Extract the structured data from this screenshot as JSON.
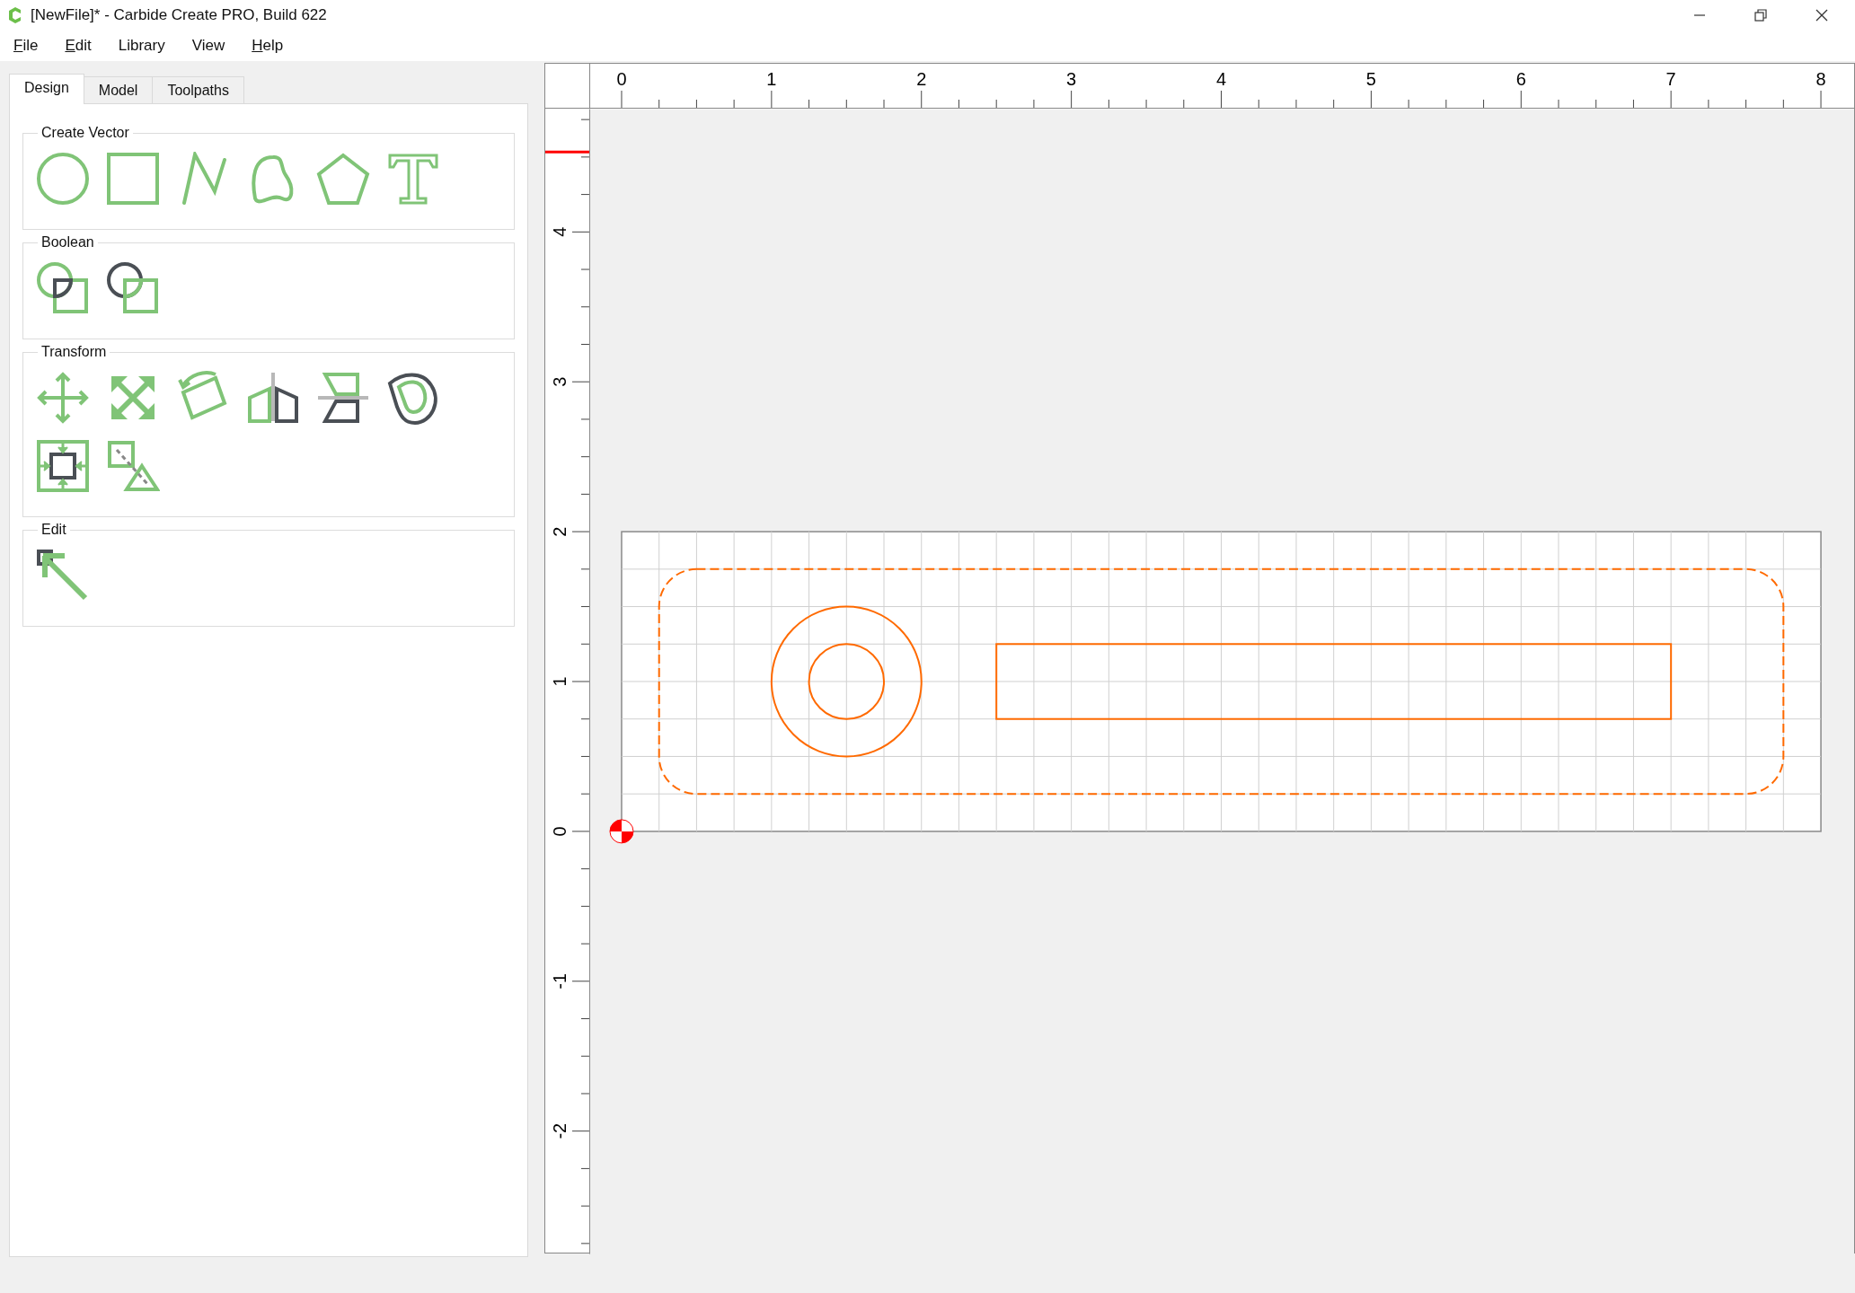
{
  "window": {
    "title": "[NewFile]* - Carbide Create PRO, Build 622"
  },
  "menu": [
    {
      "label": "File",
      "mnemonic": true
    },
    {
      "label": "Edit",
      "mnemonic": true
    },
    {
      "label": "Library",
      "mnemonic": false
    },
    {
      "label": "View",
      "mnemonic": false
    },
    {
      "label": "Help",
      "mnemonic": true
    }
  ],
  "tabs": [
    {
      "label": "Design",
      "selected": true
    },
    {
      "label": "Model",
      "selected": false
    },
    {
      "label": "Toolpaths",
      "selected": false
    }
  ],
  "sections": [
    {
      "title": "Create Vector",
      "tools": [
        {
          "kind": "circle"
        },
        {
          "kind": "rectangle"
        },
        {
          "kind": "polyline"
        },
        {
          "kind": "curve"
        },
        {
          "kind": "polygon"
        },
        {
          "kind": "text"
        }
      ]
    },
    {
      "title": "Boolean",
      "tools": [
        {
          "kind": "union"
        },
        {
          "kind": "subtract"
        }
      ]
    },
    {
      "title": "Transform",
      "tools": [
        {
          "kind": "move"
        },
        {
          "kind": "scale"
        },
        {
          "kind": "rotate"
        },
        {
          "kind": "mirror"
        },
        {
          "kind": "flip"
        },
        {
          "kind": "offset"
        },
        {
          "kind": "inset"
        },
        {
          "kind": "align"
        }
      ]
    },
    {
      "title": "Edit",
      "tools": [
        {
          "kind": "node"
        }
      ]
    }
  ],
  "rulers": {
    "horizontal": [
      "0",
      "1",
      "2",
      "3",
      "4",
      "5",
      "6",
      "7",
      "8"
    ],
    "vertical": [
      "4",
      "3",
      "2",
      "1",
      "0",
      "-1",
      "-2"
    ]
  }
}
